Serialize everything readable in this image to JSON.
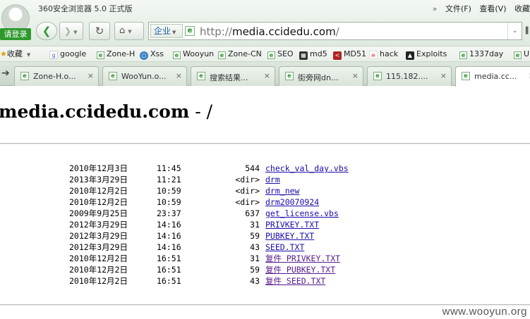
{
  "browser": {
    "app_title": "360安全浏览器 5.0 正式版",
    "login_label": "请登录",
    "menu": {
      "more_chevron": "»",
      "file": "文件(F)",
      "view": "查看(V)",
      "favorites": "收藏"
    },
    "address": {
      "mode_label": "企业",
      "url_prefix": "http://",
      "url_host": "media.ccidedu.com",
      "url_suffix": "/"
    },
    "bookmarks": [
      {
        "label": "收藏",
        "icon": "star-icon"
      },
      {
        "label": "google",
        "icon": "google-icon"
      },
      {
        "label": "Zone-H",
        "icon": "ie-page-icon"
      },
      {
        "label": "Xss",
        "icon": "globe-icon"
      },
      {
        "label": "Wooyun",
        "icon": "ie-page-icon"
      },
      {
        "label": "Zone-CN",
        "icon": "ie-page-icon"
      },
      {
        "label": "SEO",
        "icon": "ie-page-icon"
      },
      {
        "label": "md5",
        "icon": "grid-icon"
      },
      {
        "label": "MD51",
        "icon": "md5-icon"
      },
      {
        "label": "hack",
        "icon": "hack-icon"
      },
      {
        "label": "Exploits",
        "icon": "exploits-icon"
      },
      {
        "label": "1337day",
        "icon": "ie-page-icon"
      },
      {
        "label": "U",
        "icon": "ie-page-icon"
      }
    ],
    "tabs": [
      {
        "label": "Zone-H.o...",
        "close": "×"
      },
      {
        "label": "WooYun.o...",
        "close": "×"
      },
      {
        "label": "搜索结果...",
        "close": "×"
      },
      {
        "label": "街旁网dn...",
        "close": "×"
      },
      {
        "label": "115.182....",
        "close": "×"
      },
      {
        "label": "media.cc...",
        "close": "×"
      }
    ]
  },
  "page": {
    "title_host": "media.ccidedu.com",
    "title_sep": " - /",
    "entries": [
      {
        "date": "2010年12月3日",
        "time": "11:45",
        "size": "544",
        "name": "check_val_day.vbs"
      },
      {
        "date": "2013年3月29日",
        "time": "11:21",
        "size": "<dir>",
        "name": "drm"
      },
      {
        "date": "2010年12月2日",
        "time": "10:59",
        "size": "<dir>",
        "name": "drm_new"
      },
      {
        "date": "2010年12月2日",
        "time": "10:59",
        "size": "<dir>",
        "name": "drm20070924"
      },
      {
        "date": "2009年9月25日",
        "time": "23:37",
        "size": "637",
        "name": "get_license.vbs"
      },
      {
        "date": "2012年3月29日",
        "time": "14:16",
        "size": "31",
        "name": "PRIVKEY.TXT"
      },
      {
        "date": "2012年3月29日",
        "time": "14:16",
        "size": "59",
        "name": "PUBKEY.TXT"
      },
      {
        "date": "2012年3月29日",
        "time": "14:16",
        "size": "43",
        "name": "SEED.TXT"
      },
      {
        "date": "2010年12月2日",
        "time": "16:51",
        "size": "31",
        "name": "复件 PRIVKEY.TXT"
      },
      {
        "date": "2010年12月2日",
        "time": "16:51",
        "size": "59",
        "name": "复件 PUBKEY.TXT"
      },
      {
        "date": "2010年12月2日",
        "time": "16:51",
        "size": "43",
        "name": "复件 SEED.TXT"
      }
    ],
    "watermark": "www.wooyun.org"
  },
  "colors": {
    "link": "#1a0dab",
    "visited_link": "#551a8b",
    "accent_green": "#2e9a2e"
  }
}
